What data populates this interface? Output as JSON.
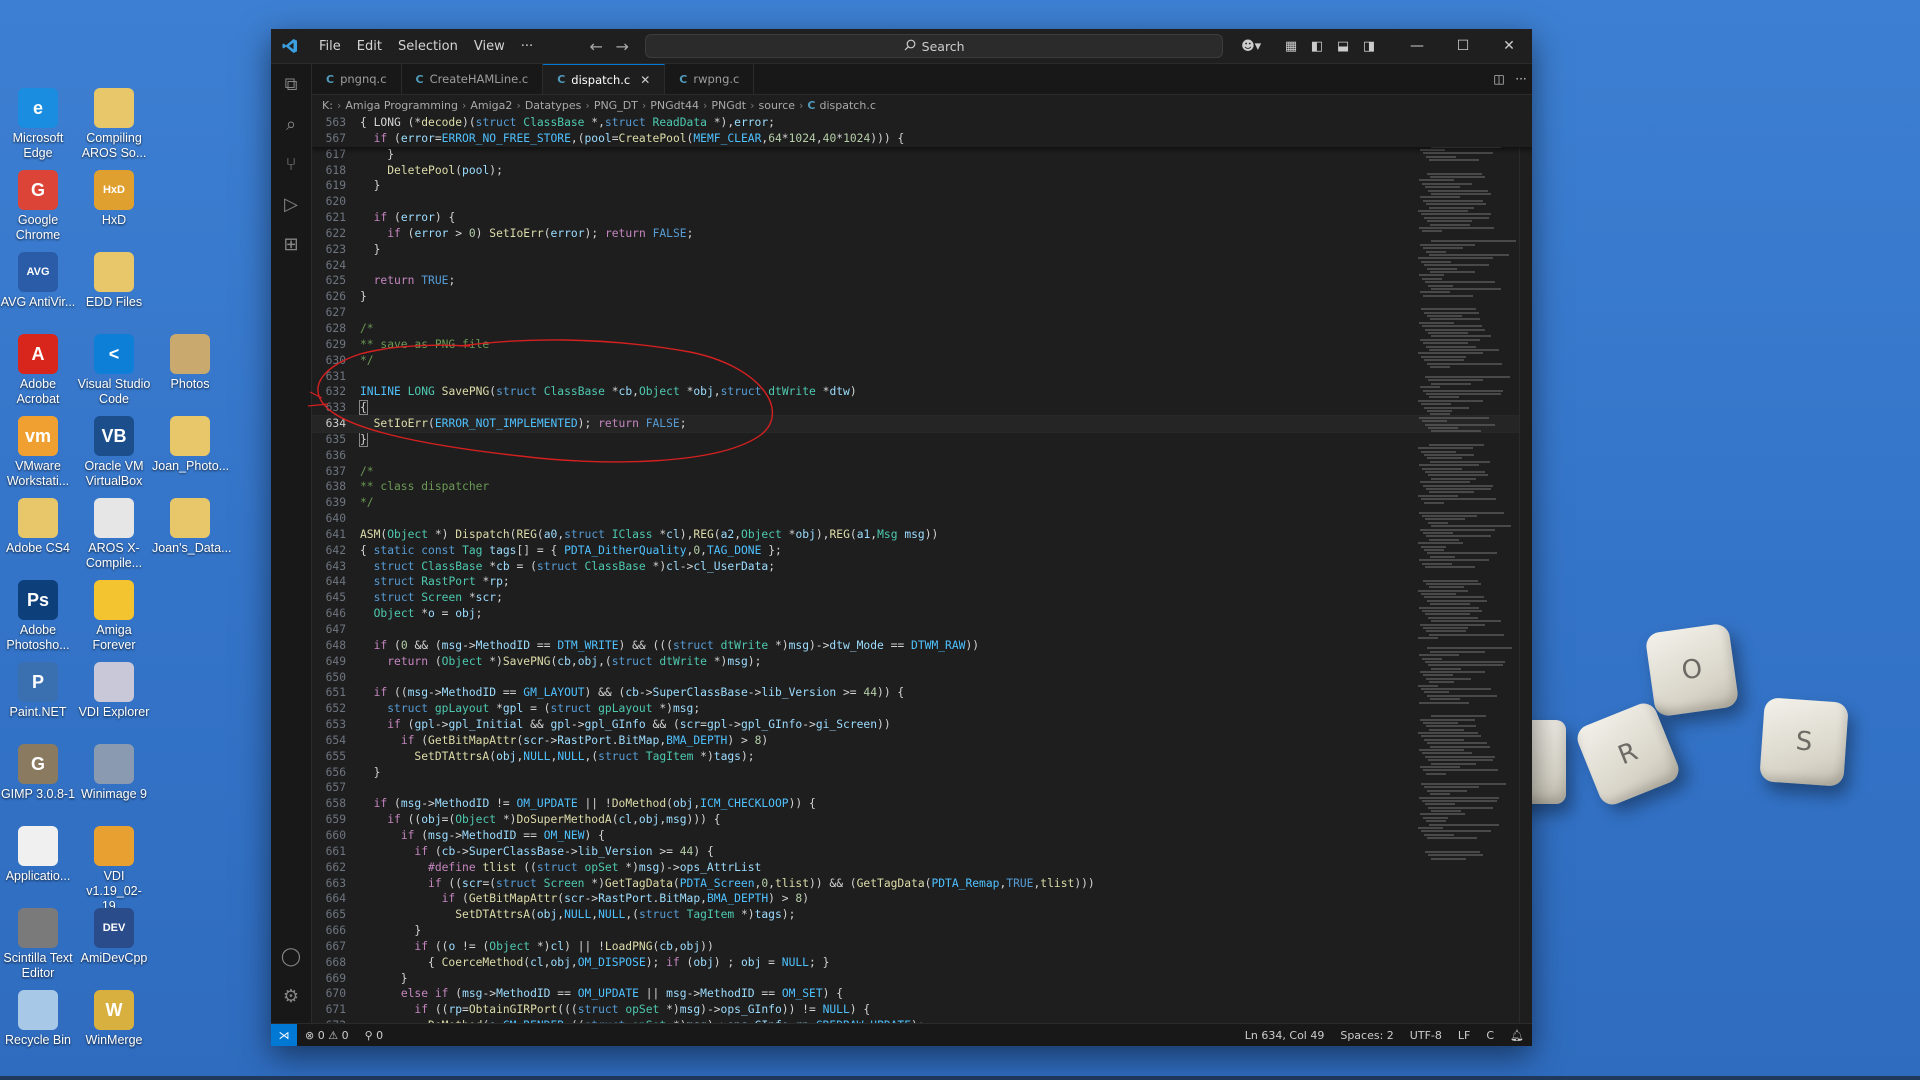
{
  "desktop": {
    "icons": [
      {
        "label": "Microsoft Edge",
        "glyph": "e",
        "color": "#1b8de0"
      },
      {
        "label": "Compiling AROS So...",
        "glyph": "",
        "color": "#e8c66a"
      },
      {
        "label": "Google Chrome",
        "glyph": "G",
        "color": "#db4437"
      },
      {
        "label": "HxD",
        "glyph": "HxD",
        "color": "#e0a030"
      },
      {
        "label": "AVG AntiVir...",
        "glyph": "AVG",
        "color": "#2a5ca8"
      },
      {
        "label": "EDD Files",
        "glyph": "",
        "color": "#e8c66a"
      },
      {
        "label": "Adobe Acrobat",
        "glyph": "A",
        "color": "#d9261c"
      },
      {
        "label": "Visual Studio Code",
        "glyph": "<",
        "color": "#0e7fd6"
      },
      {
        "label": "Photos",
        "glyph": "",
        "color": "#c9a96e"
      },
      {
        "label": "VMware Workstati...",
        "glyph": "vm",
        "color": "#f0a030"
      },
      {
        "label": "Oracle VM VirtualBox",
        "glyph": "VB",
        "color": "#1c4e8c"
      },
      {
        "label": "Joan_Photo...",
        "glyph": "",
        "color": "#e8c66a"
      },
      {
        "label": "Adobe CS4",
        "glyph": "",
        "color": "#e8c66a"
      },
      {
        "label": "AROS X-Compile...",
        "glyph": "",
        "color": "#e6e6e6"
      },
      {
        "label": "Joan's_Data...",
        "glyph": "",
        "color": "#e8c66a"
      },
      {
        "label": "Adobe Photosho...",
        "glyph": "Ps",
        "color": "#0d3f7a"
      },
      {
        "label": "Amiga Forever",
        "glyph": "",
        "color": "#f4c430"
      },
      {
        "label": "Paint.NET",
        "glyph": "P",
        "color": "#3a6fb0"
      },
      {
        "label": "VDI Explorer",
        "glyph": "",
        "color": "#c8c8d8"
      },
      {
        "label": "GIMP 3.0.8-1",
        "glyph": "G",
        "color": "#8a7a60"
      },
      {
        "label": "Winimage 9",
        "glyph": "",
        "color": "#8a9ab0"
      },
      {
        "label": "Applicatio...",
        "glyph": "",
        "color": "#f0f0f0"
      },
      {
        "label": "VDI v1.19_02-19...",
        "glyph": "",
        "color": "#e8a030"
      },
      {
        "label": "Scintilla Text Editor",
        "glyph": "",
        "color": "#7a7a7a"
      },
      {
        "label": "AmiDevCpp",
        "glyph": "DEV",
        "color": "#2a4c8a"
      },
      {
        "label": "Recycle Bin",
        "glyph": "",
        "color": "#a8c8e8"
      },
      {
        "label": "WinMerge",
        "glyph": "W",
        "color": "#d8b040"
      }
    ],
    "keycaps": [
      "O",
      "R",
      "S"
    ]
  },
  "window": {
    "menu": [
      "File",
      "Edit",
      "Selection",
      "View",
      "···"
    ],
    "search_placeholder": "Search",
    "tabs": [
      {
        "label": "pngnq.c",
        "active": false
      },
      {
        "label": "CreateHAMLine.c",
        "active": false
      },
      {
        "label": "dispatch.c",
        "active": true
      },
      {
        "label": "rwpng.c",
        "active": false
      }
    ],
    "breadcrumb": [
      "K:",
      "Amiga Programming",
      "Amiga2",
      "Datatypes",
      "PNG_DT",
      "PNGdt44",
      "PNGdt",
      "source",
      "dispatch.c"
    ],
    "sticky_lines": [
      {
        "n": "563",
        "html": "{ LONG (*<span class=\"fn\">decode</span>)(<span class=\"kw\">struct</span> <span class=\"ty\">ClassBase</span> *,<span class=\"kw\">struct</span> <span class=\"ty\">ReadData</span> *),<span class=\"var\">error</span>;"
      },
      {
        "n": "567",
        "html": "  <span class=\"pp\">if</span> (<span class=\"var\">error</span>=<span class=\"mac\">ERROR_NO_FREE_STORE</span>,(<span class=\"var\">pool</span>=<span class=\"fn\">CreatePool</span>(<span class=\"mac\">MEMF_CLEAR</span>,<span class=\"num\">64</span>*<span class=\"num\">1024</span>,<span class=\"num\">40</span>*<span class=\"num\">1024</span>))) {"
      }
    ],
    "code_lines": [
      {
        "n": "617",
        "html": "    }"
      },
      {
        "n": "618",
        "html": "    <span class=\"fn\">DeletePool</span>(<span class=\"var\">pool</span>);"
      },
      {
        "n": "619",
        "html": "  }"
      },
      {
        "n": "620",
        "html": ""
      },
      {
        "n": "621",
        "html": "  <span class=\"pp\">if</span> (<span class=\"var\">error</span>) {"
      },
      {
        "n": "622",
        "html": "    <span class=\"pp\">if</span> (<span class=\"var\">error</span> &gt; <span class=\"num\">0</span>) <span class=\"fn\">SetIoErr</span>(<span class=\"var\">error</span>); <span class=\"pp\">return</span> <span class=\"kw\">FALSE</span>;"
      },
      {
        "n": "623",
        "html": "  }"
      },
      {
        "n": "624",
        "html": ""
      },
      {
        "n": "625",
        "html": "  <span class=\"pp\">return</span> <span class=\"kw\">TRUE</span>;"
      },
      {
        "n": "626",
        "html": "}"
      },
      {
        "n": "627",
        "html": ""
      },
      {
        "n": "628",
        "html": "<span class=\"cm\">/*</span>"
      },
      {
        "n": "629",
        "html": "<span class=\"cm\">** save as PNG file</span>"
      },
      {
        "n": "630",
        "html": "<span class=\"cm\">*/</span>"
      },
      {
        "n": "631",
        "html": ""
      },
      {
        "n": "632",
        "html": "<span class=\"mac\">INLINE</span> <span class=\"ty\">LONG</span> <span class=\"fn\">SavePNG</span>(<span class=\"kw\">struct</span> <span class=\"ty\">ClassBase</span> *<span class=\"var\">cb</span>,<span class=\"ty\">Object</span> *<span class=\"var\">obj</span>,<span class=\"kw\">struct</span> <span class=\"ty\">dtWrite</span> *<span class=\"var\">dtw</span>)"
      },
      {
        "n": "633",
        "html": "<span style=\"outline:1px solid #888\">{</span>"
      },
      {
        "n": "634",
        "html": "  <span class=\"fn\">SetIoErr</span>(<span class=\"mac\">ERROR_NOT_IMPLEMENTED</span>); <span class=\"pp\">return</span> <span class=\"kw\">FALSE</span>;",
        "current": true
      },
      {
        "n": "635",
        "html": "<span style=\"outline:1px solid #888\">}</span>"
      },
      {
        "n": "636",
        "html": ""
      },
      {
        "n": "637",
        "html": "<span class=\"cm\">/*</span>"
      },
      {
        "n": "638",
        "html": "<span class=\"cm\">** class dispatcher</span>"
      },
      {
        "n": "639",
        "html": "<span class=\"cm\">*/</span>"
      },
      {
        "n": "640",
        "html": ""
      },
      {
        "n": "641",
        "html": "<span class=\"fn\">ASM</span>(<span class=\"ty\">Object</span> *) <span class=\"fn\">Dispatch</span>(<span class=\"fn\">REG</span>(<span class=\"var\">a0</span>,<span class=\"kw\">struct</span> <span class=\"ty\">IClass</span> *<span class=\"var\">cl</span>),<span class=\"fn\">REG</span>(<span class=\"var\">a2</span>,<span class=\"ty\">Object</span> *<span class=\"var\">obj</span>),<span class=\"fn\">REG</span>(<span class=\"var\">a1</span>,<span class=\"ty\">Msg</span> <span class=\"var\">msg</span>))"
      },
      {
        "n": "642",
        "html": "{ <span class=\"kw\">static</span> <span class=\"kw\">const</span> <span class=\"ty\">Tag</span> <span class=\"var\">tags</span>[] = { <span class=\"mac\">PDTA_DitherQuality</span>,<span class=\"num\">0</span>,<span class=\"mac\">TAG_DONE</span> };"
      },
      {
        "n": "643",
        "html": "  <span class=\"kw\">struct</span> <span class=\"ty\">ClassBase</span> *<span class=\"var\">cb</span> = (<span class=\"kw\">struct</span> <span class=\"ty\">ClassBase</span> *)<span class=\"var\">cl</span>-&gt;<span class=\"var\">cl_UserData</span>;"
      },
      {
        "n": "644",
        "html": "  <span class=\"kw\">struct</span> <span class=\"ty\">RastPort</span> *<span class=\"var\">rp</span>;"
      },
      {
        "n": "645",
        "html": "  <span class=\"kw\">struct</span> <span class=\"ty\">Screen</span> *<span class=\"var\">scr</span>;"
      },
      {
        "n": "646",
        "html": "  <span class=\"ty\">Object</span> *<span class=\"var\">o</span> = <span class=\"var\">obj</span>;"
      },
      {
        "n": "647",
        "html": ""
      },
      {
        "n": "648",
        "html": "  <span class=\"pp\">if</span> (<span class=\"num\">0</span> &amp;&amp; (<span class=\"var\">msg</span>-&gt;<span class=\"var\">MethodID</span> == <span class=\"mac\">DTM_WRITE</span>) &amp;&amp; (((<span class=\"kw\">struct</span> <span class=\"ty\">dtWrite</span> *)<span class=\"var\">msg</span>)-&gt;<span class=\"var\">dtw_Mode</span> == <span class=\"mac\">DTWM_RAW</span>))"
      },
      {
        "n": "649",
        "html": "    <span class=\"pp\">return</span> (<span class=\"ty\">Object</span> *)<span class=\"fn\">SavePNG</span>(<span class=\"var\">cb</span>,<span class=\"var\">obj</span>,(<span class=\"kw\">struct</span> <span class=\"ty\">dtWrite</span> *)<span class=\"var\">msg</span>);"
      },
      {
        "n": "650",
        "html": ""
      },
      {
        "n": "651",
        "html": "  <span class=\"pp\">if</span> ((<span class=\"var\">msg</span>-&gt;<span class=\"var\">MethodID</span> == <span class=\"mac\">GM_LAYOUT</span>) &amp;&amp; (<span class=\"var\">cb</span>-&gt;<span class=\"var\">SuperClassBase</span>-&gt;<span class=\"var\">lib_Version</span> &gt;= <span class=\"num\">44</span>)) {"
      },
      {
        "n": "652",
        "html": "    <span class=\"kw\">struct</span> <span class=\"ty\">gpLayout</span> *<span class=\"var\">gpl</span> = (<span class=\"kw\">struct</span> <span class=\"ty\">gpLayout</span> *)<span class=\"var\">msg</span>;"
      },
      {
        "n": "653",
        "html": "    <span class=\"pp\">if</span> (<span class=\"var\">gpl</span>-&gt;<span class=\"var\">gpl_Initial</span> &amp;&amp; <span class=\"var\">gpl</span>-&gt;<span class=\"var\">gpl_GInfo</span> &amp;&amp; (<span class=\"var\">scr</span>=<span class=\"var\">gpl</span>-&gt;<span class=\"var\">gpl_GInfo</span>-&gt;<span class=\"var\">gi_Screen</span>))"
      },
      {
        "n": "654",
        "html": "      <span class=\"pp\">if</span> (<span class=\"fn\">GetBitMapAttr</span>(<span class=\"var\">scr</span>-&gt;<span class=\"var\">RastPort</span>.<span class=\"var\">BitMap</span>,<span class=\"mac\">BMA_DEPTH</span>) &gt; <span class=\"num\">8</span>)"
      },
      {
        "n": "655",
        "html": "        <span class=\"fn\">SetDTAttrsA</span>(<span class=\"var\">obj</span>,<span class=\"mac\">NULL</span>,<span class=\"mac\">NULL</span>,(<span class=\"kw\">struct</span> <span class=\"ty\">TagItem</span> *)<span class=\"var\">tags</span>);"
      },
      {
        "n": "656",
        "html": "  }"
      },
      {
        "n": "657",
        "html": ""
      },
      {
        "n": "658",
        "html": "  <span class=\"pp\">if</span> (<span class=\"var\">msg</span>-&gt;<span class=\"var\">MethodID</span> != <span class=\"mac\">OM_UPDATE</span> || !<span class=\"fn\">DoMethod</span>(<span class=\"var\">obj</span>,<span class=\"mac\">ICM_CHECKLOOP</span>)) {"
      },
      {
        "n": "659",
        "html": "    <span class=\"pp\">if</span> ((<span class=\"var\">obj</span>=(<span class=\"ty\">Object</span> *)<span class=\"fn\">DoSuperMethodA</span>(<span class=\"var\">cl</span>,<span class=\"var\">obj</span>,<span class=\"var\">msg</span>))) {"
      },
      {
        "n": "660",
        "html": "      <span class=\"pp\">if</span> (<span class=\"var\">msg</span>-&gt;<span class=\"var\">MethodID</span> == <span class=\"mac\">OM_NEW</span>) {"
      },
      {
        "n": "661",
        "html": "        <span class=\"pp\">if</span> (<span class=\"var\">cb</span>-&gt;<span class=\"var\">SuperClassBase</span>-&gt;<span class=\"var\">lib_Version</span> &gt;= <span class=\"num\">44</span>) {"
      },
      {
        "n": "662",
        "html": "          <span class=\"pp\">#define</span> <span class=\"fn\">tlist</span> ((<span class=\"kw\">struct</span> <span class=\"ty\">opSet</span> *)<span class=\"var\">msg</span>)-&gt;<span class=\"var\">ops_AttrList</span>"
      },
      {
        "n": "663",
        "html": "          <span class=\"pp\">if</span> ((<span class=\"var\">scr</span>=(<span class=\"kw\">struct</span> <span class=\"ty\">Screen</span> *)<span class=\"fn\">GetTagData</span>(<span class=\"mac\">PDTA_Screen</span>,<span class=\"num\">0</span>,<span class=\"fn\">tlist</span>)) &amp;&amp; (<span class=\"fn\">GetTagData</span>(<span class=\"mac\">PDTA_Remap</span>,<span class=\"kw\">TRUE</span>,<span class=\"fn\">tlist</span>)))"
      },
      {
        "n": "664",
        "html": "            <span class=\"pp\">if</span> (<span class=\"fn\">GetBitMapAttr</span>(<span class=\"var\">scr</span>-&gt;<span class=\"var\">RastPort</span>.<span class=\"var\">BitMap</span>,<span class=\"mac\">BMA_DEPTH</span>) &gt; <span class=\"num\">8</span>)"
      },
      {
        "n": "665",
        "html": "              <span class=\"fn\">SetDTAttrsA</span>(<span class=\"var\">obj</span>,<span class=\"mac\">NULL</span>,<span class=\"mac\">NULL</span>,(<span class=\"kw\">struct</span> <span class=\"ty\">TagItem</span> *)<span class=\"var\">tags</span>);"
      },
      {
        "n": "666",
        "html": "        }"
      },
      {
        "n": "667",
        "html": "        <span class=\"pp\">if</span> ((<span class=\"var\">o</span> != (<span class=\"ty\">Object</span> *)<span class=\"var\">cl</span>) || !<span class=\"fn\">LoadPNG</span>(<span class=\"var\">cb</span>,<span class=\"var\">obj</span>))"
      },
      {
        "n": "668",
        "html": "          { <span class=\"fn\">CoerceMethod</span>(<span class=\"var\">cl</span>,<span class=\"var\">obj</span>,<span class=\"mac\">OM_DISPOSE</span>); <span class=\"pp\">if</span> (<span class=\"var\">obj</span>) ; <span class=\"var\">obj</span> = <span class=\"mac\">NULL</span>; }"
      },
      {
        "n": "669",
        "html": "      }"
      },
      {
        "n": "670",
        "html": "      <span class=\"pp\">else</span> <span class=\"pp\">if</span> (<span class=\"var\">msg</span>-&gt;<span class=\"var\">MethodID</span> == <span class=\"mac\">OM_UPDATE</span> || <span class=\"var\">msg</span>-&gt;<span class=\"var\">MethodID</span> == <span class=\"mac\">OM_SET</span>) {"
      },
      {
        "n": "671",
        "html": "        <span class=\"pp\">if</span> ((<span class=\"var\">rp</span>=<span class=\"fn\">ObtainGIRPort</span>(((<span class=\"kw\">struct</span> <span class=\"ty\">opSet</span> *)<span class=\"var\">msg</span>)-&gt;<span class=\"var\">ops_GInfo</span>)) != <span class=\"mac\">NULL</span>) {"
      },
      {
        "n": "672",
        "html": "          <span class=\"fn\">DoMethod</span>(<span class=\"var\">o</span>,<span class=\"mac\">GM_RENDER</span>,((<span class=\"kw\">struct</span> <span class=\"ty\">opSet</span> *)<span class=\"var\">msg</span>)-&gt;<span class=\"var\">ops_GInfo</span>,<span class=\"var\">rp</span>,<span class=\"mac\">GREDRAW_UPDATE</span>);"
      }
    ],
    "current_line": "634",
    "status": {
      "problems": "⊗ 0 ⚠ 0",
      "ports": "⚲ 0",
      "position": "Ln 634, Col 49",
      "spaces": "Spaces: 2",
      "encoding": "UTF-8",
      "eol": "LF",
      "language": "C"
    }
  }
}
